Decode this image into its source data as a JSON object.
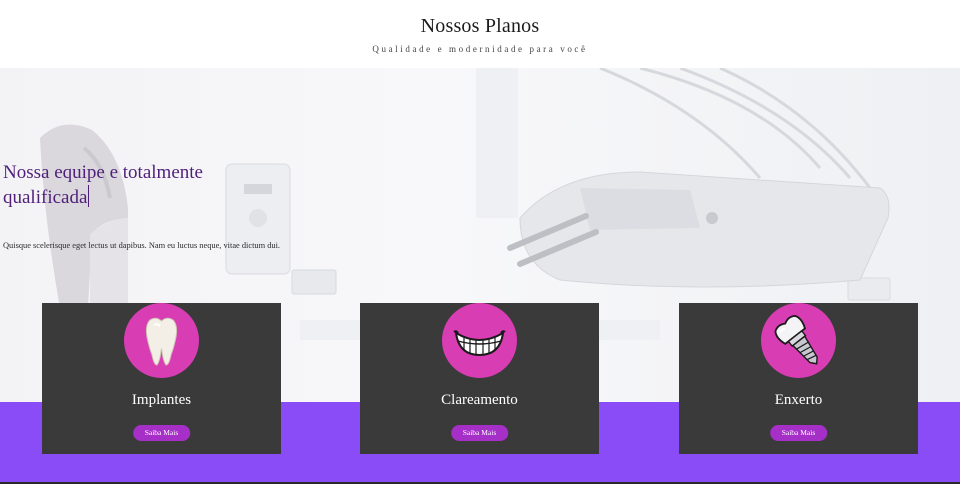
{
  "header": {
    "title": "Nossos Planos",
    "subtitle": "Qualidade e modernidade para você"
  },
  "hero": {
    "heading": "Nossa equipe e totalmente qualificada",
    "text": "Quisque scelerisque eget lectus ut dapibus. Nam eu luctus neque, vitae dictum dui."
  },
  "colors": {
    "accent_band": "#8a4cf6",
    "card_background": "#3a3a3a",
    "icon_circle": "#d93db4",
    "button": "#a52fc7",
    "heading": "#4f1f7a"
  },
  "plans": [
    {
      "name": "Implantes",
      "button_label": "Saiba Mais",
      "icon": "tooth-icon"
    },
    {
      "name": "Clareamento",
      "button_label": "Saiba Mais",
      "icon": "smile-teeth-icon"
    },
    {
      "name": "Enxerto",
      "button_label": "Saiba Mais",
      "icon": "dental-implant-icon"
    }
  ]
}
